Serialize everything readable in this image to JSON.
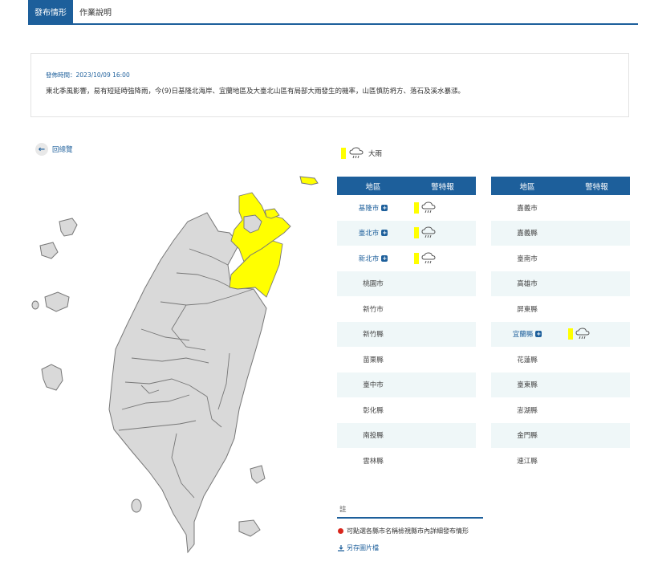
{
  "tabs": [
    {
      "label": "發布情形",
      "active": true
    },
    {
      "label": "作業說明",
      "active": false
    }
  ],
  "alert": {
    "time": "發佈時間：2023/10/09 16:00",
    "text": "東北季風影響，易有短延時強降雨，今(9)日基隆北海岸、宜蘭地區及大臺北山區有局部大雨發生的機率，山區慎防坍方、落石及溪水暴漲。"
  },
  "back_label": "回總覽",
  "legend": {
    "color": "#ffff00",
    "icon": "heavy-rain-icon",
    "label": "大雨"
  },
  "table_headers": {
    "region": "地區",
    "warning": "警特報"
  },
  "left_rows": [
    {
      "name": "基隆市",
      "warned": true
    },
    {
      "name": "臺北市",
      "warned": true
    },
    {
      "name": "新北市",
      "warned": true
    },
    {
      "name": "桃園市",
      "warned": false
    },
    {
      "name": "新竹市",
      "warned": false
    },
    {
      "name": "新竹縣",
      "warned": false
    },
    {
      "name": "苗栗縣",
      "warned": false
    },
    {
      "name": "臺中市",
      "warned": false
    },
    {
      "name": "彰化縣",
      "warned": false
    },
    {
      "name": "南投縣",
      "warned": false
    },
    {
      "name": "雲林縣",
      "warned": false
    }
  ],
  "right_rows": [
    {
      "name": "嘉義市",
      "warned": false
    },
    {
      "name": "嘉義縣",
      "warned": false
    },
    {
      "name": "臺南市",
      "warned": false
    },
    {
      "name": "高雄市",
      "warned": false
    },
    {
      "name": "屏東縣",
      "warned": false
    },
    {
      "name": "宜蘭縣",
      "warned": true
    },
    {
      "name": "花蓮縣",
      "warned": false
    },
    {
      "name": "臺東縣",
      "warned": false
    },
    {
      "name": "澎湖縣",
      "warned": false
    },
    {
      "name": "金門縣",
      "warned": false
    },
    {
      "name": "連江縣",
      "warned": false
    }
  ],
  "note": {
    "title": "註",
    "tip": "可點選各縣市名稱檢視縣市內詳細發布情形",
    "download": "另存圖片檔"
  },
  "colors": {
    "accent": "#1d5f9b",
    "warning": "#ffff00",
    "land": "#d9d9d9"
  }
}
